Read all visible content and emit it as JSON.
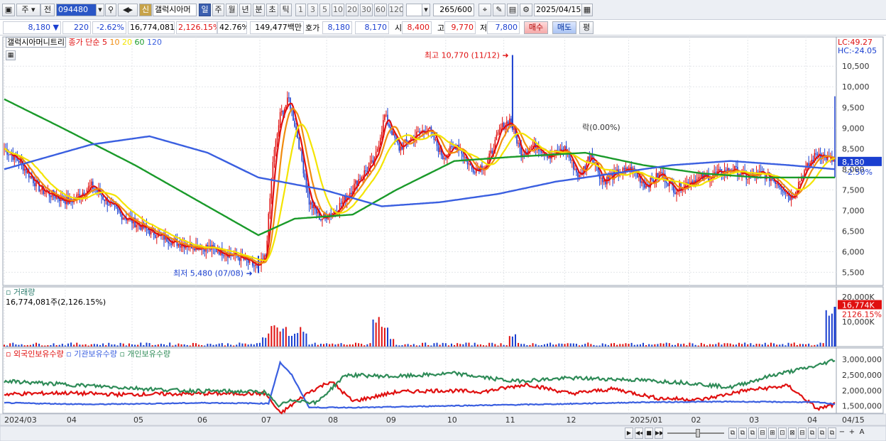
{
  "toolbar": {
    "market": "주",
    "prefix": "전",
    "code": "094480",
    "credit_badge": "신",
    "stock_name": "갤럭시아머",
    "periods": [
      "일",
      "주",
      "월",
      "년",
      "분",
      "초",
      "틱"
    ],
    "selected_period": "일",
    "intervals": [
      "1",
      "3",
      "5",
      "10",
      "20",
      "30",
      "60",
      "120"
    ],
    "count": "265",
    "count_max": "/600",
    "date": "2025/04/15"
  },
  "quote": {
    "price": "8,180",
    "change": "220",
    "change_pct": "-2.62%",
    "volume": "16,774,081",
    "volume_pct": "2,126.15%",
    "turnover_ratio": "42.76%",
    "amount": "149,477백만",
    "bid_label": "호가",
    "bid": "8,180",
    "ask": "8,170",
    "open_label": "시",
    "open": "8,400",
    "high_label": "고",
    "high": "9,770",
    "low_label": "저",
    "low": "7,800",
    "buy_label": "매수",
    "sell_label": "매도",
    "eval_label": "평"
  },
  "price_panel": {
    "legend_name": "갤럭시아머니트리",
    "legend_ma_title": "종가 단순",
    "ma_periods": [
      "5",
      "10",
      "20",
      "60",
      "120"
    ],
    "ma_colors": [
      "#e01010",
      "#f08c10",
      "#f4e400",
      "#1a9a2a",
      "#3a5fe0"
    ],
    "lc": "LC:49.27",
    "hc": "HC:-24.05",
    "y_ticks": [
      "10,500",
      "10,000",
      "9,500",
      "9,000",
      "8,500",
      "8,000",
      "7,500",
      "7,000",
      "6,500",
      "6,000",
      "5,500"
    ],
    "current_price_tag": "8,180",
    "current_pct_tag": "-2.50%",
    "high_annotation": "최고 10,770 (11/12)",
    "low_annotation": "최저 5,480 (07/08)",
    "lock_annotation": "락(0.00%)"
  },
  "volume_panel": {
    "title": "거래량",
    "value_label": "16,774,081주(2,126.15%)",
    "y_ticks": [
      "20,000K",
      "10,000K"
    ],
    "current_tag": "16,774K",
    "current_pct": "2126.15%"
  },
  "holding_panel": {
    "series": [
      "외국인보유수량",
      "기관보유수량",
      "개인보유수량"
    ],
    "series_colors": [
      "#e01010",
      "#3a5fe0",
      "#2e8b57"
    ],
    "y_ticks": [
      "3,000,000",
      "2,500,000",
      "2,000,000",
      "1,500,000"
    ]
  },
  "x_axis": {
    "labels": [
      "2024/03",
      "04",
      "05",
      "06",
      "07",
      "08",
      "09",
      "10",
      "11",
      "12",
      "2025/01",
      "02",
      "03",
      "04"
    ],
    "right_label": "04/15"
  },
  "chart_data": {
    "type": "candlestick",
    "y_range_price": [
      5300,
      10900
    ],
    "notable": {
      "high": 10770,
      "high_date": "11/12",
      "low": 5480,
      "low_date": "07/08",
      "last": 8180
    },
    "close_keypoints": [
      [
        0,
        8500
      ],
      [
        10,
        8200
      ],
      [
        25,
        7500
      ],
      [
        45,
        7200
      ],
      [
        60,
        7600
      ],
      [
        80,
        6900
      ],
      [
        100,
        6500
      ],
      [
        120,
        6200
      ],
      [
        140,
        6100
      ],
      [
        160,
        5900
      ],
      [
        175,
        5600
      ],
      [
        180,
        5900
      ],
      [
        185,
        8200
      ],
      [
        190,
        9300
      ],
      [
        196,
        9700
      ],
      [
        202,
        8800
      ],
      [
        210,
        7200
      ],
      [
        218,
        6800
      ],
      [
        228,
        7000
      ],
      [
        235,
        7300
      ],
      [
        245,
        7800
      ],
      [
        255,
        8200
      ],
      [
        262,
        9300
      ],
      [
        272,
        8500
      ],
      [
        282,
        8800
      ],
      [
        292,
        9000
      ],
      [
        302,
        8300
      ],
      [
        312,
        8600
      ],
      [
        322,
        8000
      ],
      [
        332,
        8100
      ],
      [
        342,
        9000
      ],
      [
        348,
        9200
      ],
      [
        356,
        8400
      ],
      [
        366,
        8600
      ],
      [
        376,
        8300
      ],
      [
        386,
        8500
      ],
      [
        396,
        7800
      ],
      [
        404,
        8400
      ],
      [
        412,
        7700
      ],
      [
        422,
        7900
      ],
      [
        432,
        8000
      ],
      [
        442,
        7600
      ],
      [
        452,
        7900
      ],
      [
        462,
        7500
      ],
      [
        472,
        7700
      ],
      [
        482,
        7800
      ],
      [
        492,
        7900
      ],
      [
        502,
        8000
      ],
      [
        512,
        7800
      ],
      [
        522,
        7900
      ],
      [
        532,
        7700
      ],
      [
        542,
        7300
      ],
      [
        550,
        7900
      ],
      [
        560,
        8400
      ],
      [
        572,
        8180
      ]
    ],
    "ma60_keypoints": [
      [
        0,
        9700
      ],
      [
        40,
        9000
      ],
      [
        90,
        8100
      ],
      [
        140,
        7100
      ],
      [
        175,
        6400
      ],
      [
        200,
        6800
      ],
      [
        240,
        6900
      ],
      [
        270,
        7500
      ],
      [
        310,
        8200
      ],
      [
        350,
        8300
      ],
      [
        400,
        8400
      ],
      [
        440,
        8100
      ],
      [
        480,
        7900
      ],
      [
        520,
        7800
      ],
      [
        572,
        7800
      ]
    ],
    "ma120_keypoints": [
      [
        0,
        8000
      ],
      [
        60,
        8600
      ],
      [
        100,
        8800
      ],
      [
        140,
        8400
      ],
      [
        175,
        7800
      ],
      [
        220,
        7500
      ],
      [
        260,
        7100
      ],
      [
        300,
        7200
      ],
      [
        340,
        7400
      ],
      [
        380,
        7700
      ],
      [
        420,
        7900
      ],
      [
        460,
        8100
      ],
      [
        500,
        8200
      ],
      [
        540,
        8100
      ],
      [
        572,
        8000
      ]
    ],
    "volume_spikes": [
      [
        180,
        4
      ],
      [
        186,
        9
      ],
      [
        192,
        8
      ],
      [
        200,
        6
      ],
      [
        256,
        12
      ],
      [
        262,
        8
      ],
      [
        350,
        5
      ],
      [
        568,
        16
      ]
    ],
    "holding_keypoints": {
      "foreign": [
        [
          0,
          1880
        ],
        [
          40,
          1920
        ],
        [
          80,
          1870
        ],
        [
          140,
          1900
        ],
        [
          180,
          1900
        ],
        [
          190,
          1250
        ],
        [
          210,
          1950
        ],
        [
          225,
          2300
        ],
        [
          240,
          1650
        ],
        [
          270,
          1950
        ],
        [
          300,
          2000
        ],
        [
          330,
          1960
        ],
        [
          360,
          2200
        ],
        [
          390,
          1900
        ],
        [
          420,
          2050
        ],
        [
          450,
          1750
        ],
        [
          480,
          1700
        ],
        [
          510,
          2000
        ],
        [
          540,
          2150
        ],
        [
          560,
          1400
        ],
        [
          572,
          1550
        ]
      ],
      "institution": [
        [
          0,
          1600
        ],
        [
          60,
          1550
        ],
        [
          140,
          1600
        ],
        [
          182,
          1580
        ],
        [
          190,
          2900
        ],
        [
          198,
          2500
        ],
        [
          210,
          1450
        ],
        [
          250,
          1450
        ],
        [
          300,
          1500
        ],
        [
          380,
          1560
        ],
        [
          440,
          1620
        ],
        [
          500,
          1640
        ],
        [
          560,
          1620
        ],
        [
          572,
          1560
        ]
      ],
      "individual": [
        [
          0,
          2300
        ],
        [
          40,
          2200
        ],
        [
          120,
          2000
        ],
        [
          180,
          1950
        ],
        [
          188,
          1500
        ],
        [
          200,
          1700
        ],
        [
          215,
          1600
        ],
        [
          235,
          2500
        ],
        [
          270,
          2450
        ],
        [
          310,
          2550
        ],
        [
          350,
          2300
        ],
        [
          390,
          2400
        ],
        [
          430,
          2350
        ],
        [
          470,
          2250
        ],
        [
          500,
          2100
        ],
        [
          530,
          2500
        ],
        [
          560,
          2800
        ],
        [
          572,
          3000
        ]
      ]
    }
  }
}
